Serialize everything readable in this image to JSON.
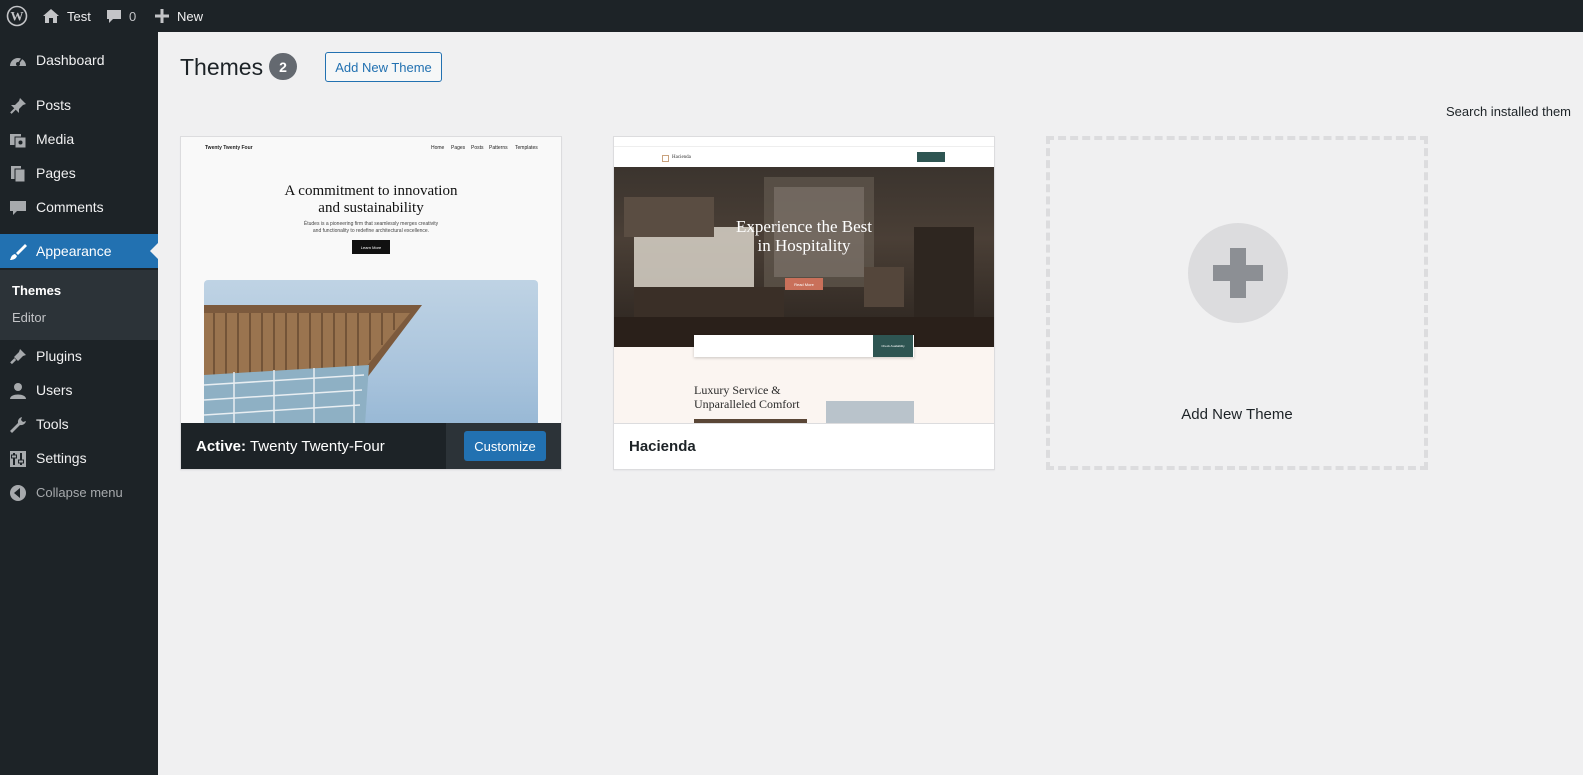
{
  "adminbar": {
    "site_name": "Test",
    "comments_count": "0",
    "new_label": "New"
  },
  "sidebar": {
    "items": [
      {
        "label": "Dashboard",
        "icon": "dashboard-icon"
      },
      {
        "label": "Posts",
        "icon": "pushpin-icon"
      },
      {
        "label": "Media",
        "icon": "media-icon"
      },
      {
        "label": "Pages",
        "icon": "pages-icon"
      },
      {
        "label": "Comments",
        "icon": "comment-icon"
      },
      {
        "label": "Appearance",
        "icon": "paintbrush-icon"
      },
      {
        "label": "Plugins",
        "icon": "plugin-icon"
      },
      {
        "label": "Users",
        "icon": "user-icon"
      },
      {
        "label": "Tools",
        "icon": "wrench-icon"
      },
      {
        "label": "Settings",
        "icon": "settings-icon"
      },
      {
        "label": "Collapse menu",
        "icon": "collapse-icon"
      }
    ],
    "submenu": [
      "Themes",
      "Editor"
    ]
  },
  "page": {
    "title": "Themes",
    "count": "2",
    "add_new": "Add New Theme",
    "search_label": "Search installed them"
  },
  "themes": [
    {
      "active_prefix": "Active:",
      "name": "Twenty Twenty-Four",
      "action": "Customize",
      "preview": {
        "site_title": "Twenty Twenty Four",
        "nav": [
          "Home",
          "Pages",
          "Posts",
          "Patterns",
          "Templates"
        ],
        "headline_1": "A commitment to innovation",
        "headline_2": "and sustainability",
        "para_1": "Études is a pioneering firm that seamlessly merges creativity",
        "para_2": "and functionality to redefine architectural excellence.",
        "button": "Learn More"
      }
    },
    {
      "name": "Hacienda",
      "preview": {
        "brand": "Hacienda",
        "headline_1": "Experience the Best",
        "headline_2": "in Hospitality",
        "button": "Read More",
        "check": "Check Availability",
        "section_1": "Luxury Service &",
        "section_2": "Unparalleled Comfort"
      }
    }
  ],
  "add_theme_card": {
    "label": "Add New Theme"
  },
  "colors": {
    "admin_dark": "#1d2327",
    "accent": "#2271b1",
    "background": "#f0f0f1"
  }
}
